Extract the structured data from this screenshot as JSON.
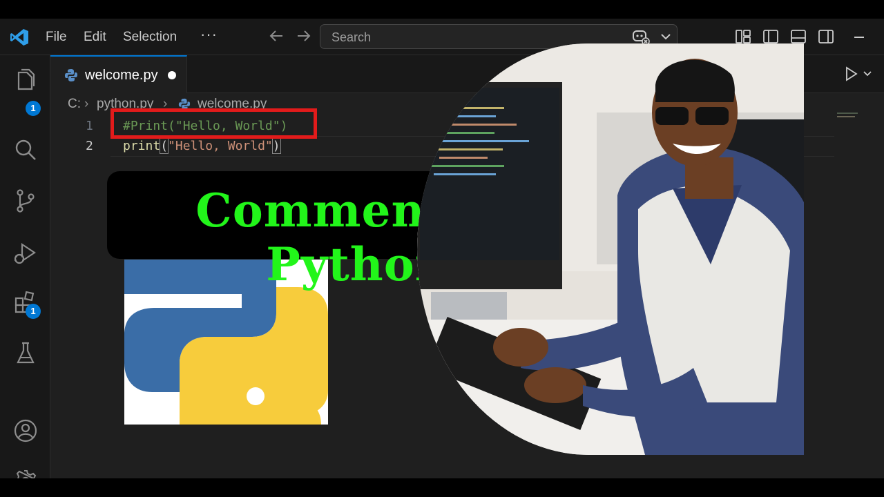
{
  "titlebar": {
    "menu": [
      "File",
      "Edit",
      "Selection"
    ],
    "more": "···",
    "search_placeholder": "Search"
  },
  "activity": {
    "explorer_badge": "1",
    "extensions_badge": "1"
  },
  "tab": {
    "label": "welcome.py"
  },
  "breadcrumb": [
    "C:",
    "python.py",
    "welcome.py"
  ],
  "editor": {
    "line_numbers": [
      "1",
      "2"
    ],
    "line1": "#Print(\"Hello, World\")",
    "line2": {
      "fn": "print",
      "open": "(",
      "str": "\"Hello, World\"",
      "close": ")"
    }
  },
  "banner": {
    "text": "Comment In Python"
  },
  "colors": {
    "accent": "#0078d4",
    "banner_text": "#22f51a",
    "highlight": "#e21b1b",
    "python_blue": "#3a6da7",
    "python_yellow": "#f7cc3c"
  }
}
